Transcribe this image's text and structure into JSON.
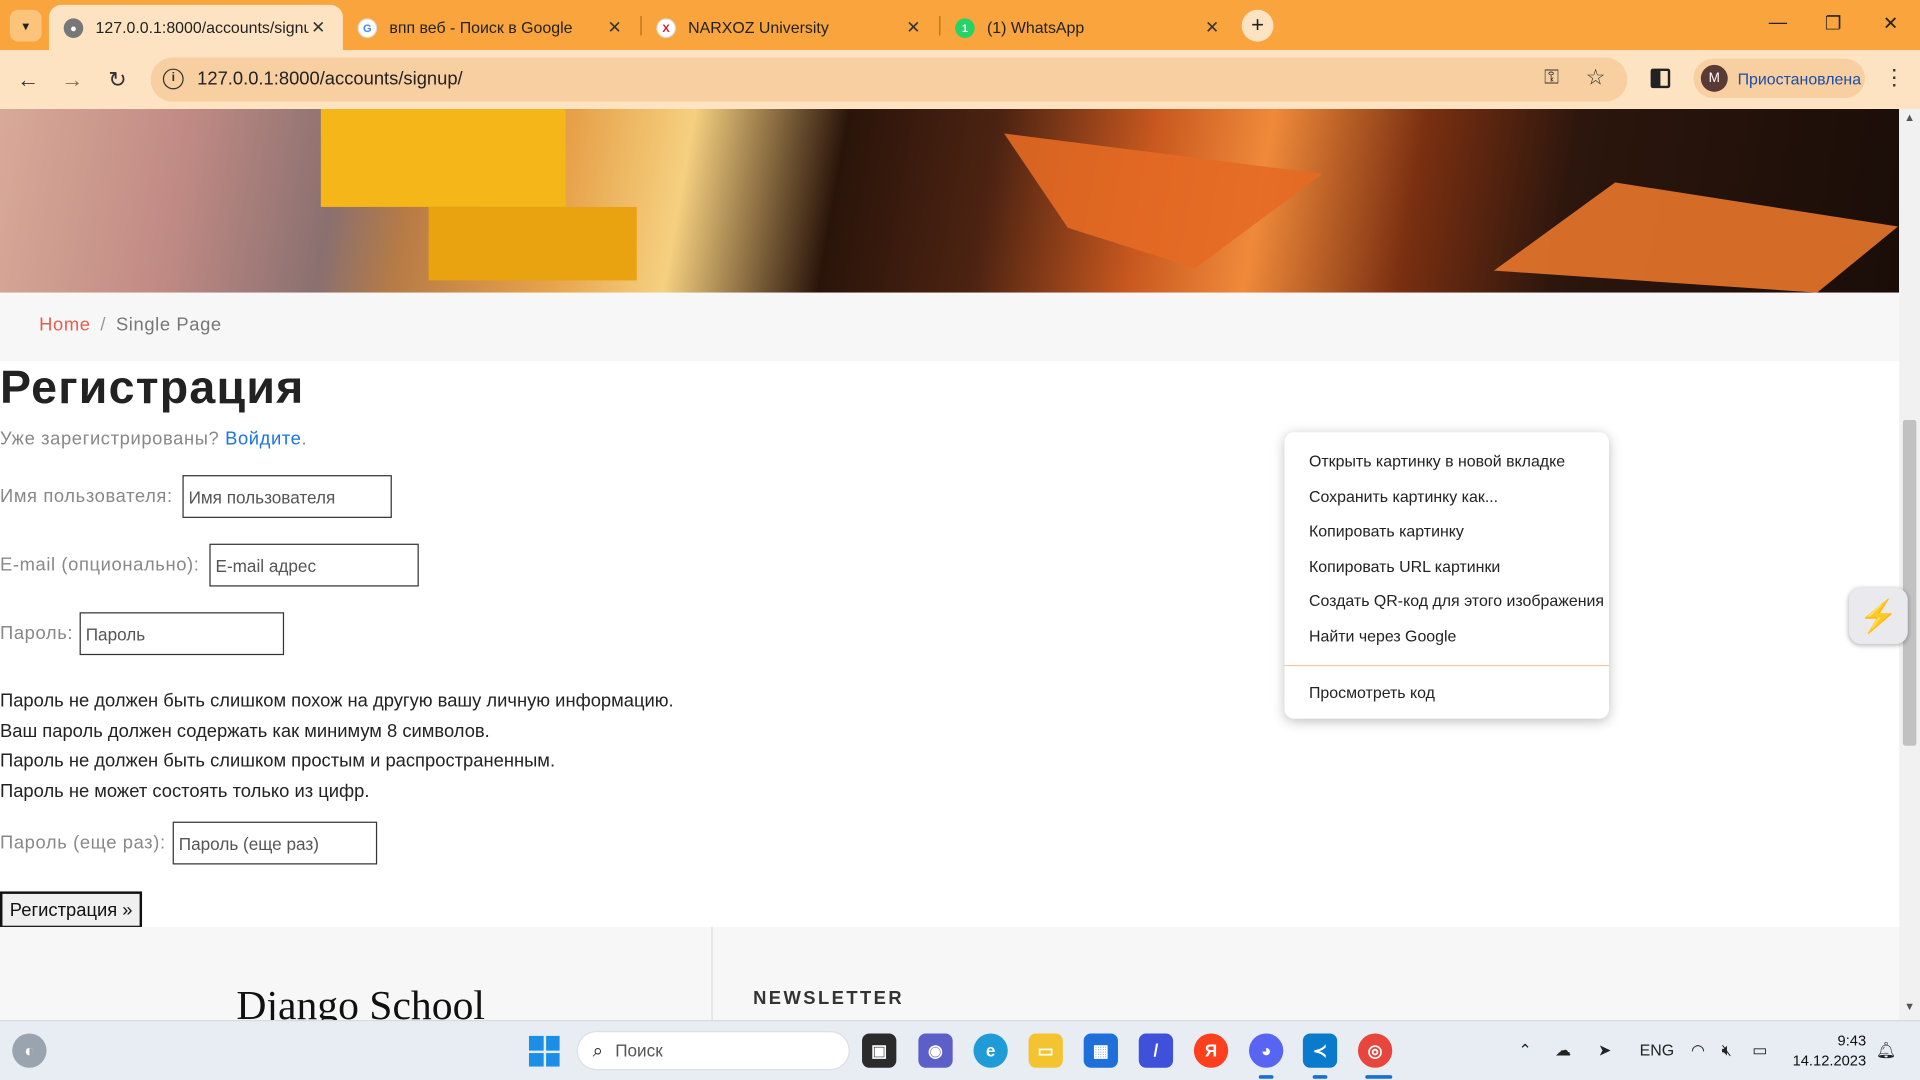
{
  "browser": {
    "tabs": [
      {
        "title": "127.0.0.1:8000/accounts/signup",
        "active": true,
        "favicon": "globe-icon"
      },
      {
        "title": "впп веб - Поиск в Google",
        "active": false,
        "favicon": "google-icon"
      },
      {
        "title": "NARXOZ University",
        "active": false,
        "favicon": "narxoz-icon"
      },
      {
        "title": "(1) WhatsApp",
        "active": false,
        "favicon": "whatsapp-icon"
      }
    ],
    "url": "127.0.0.1:8000/accounts/signup/",
    "profile_initial": "M",
    "profile_status": "Приостановлена"
  },
  "page": {
    "breadcrumb": {
      "home": "Home",
      "sep": "/",
      "current": "Single Page"
    },
    "heading": "Регистрация",
    "already_text": "Уже зарегистрированы?",
    "login_link": "Войдите",
    "login_dot": ".",
    "fields": {
      "username_label": "Имя пользователя:",
      "username_placeholder": "Имя пользователя",
      "email_label": "E-mail (опционально):",
      "email_placeholder": "E-mail адрес",
      "password_label": "Пароль:",
      "password_placeholder": "Пароль",
      "password2_label": "Пароль (еще раз):",
      "password2_placeholder": "Пароль (еще раз)"
    },
    "help_text": [
      "Пароль не должен быть слишком похож на другую вашу личную информацию.",
      "Ваш пароль должен содержать как минимум 8 символов.",
      "Пароль не должен быть слишком простым и распространенным.",
      "Пароль не может состоять только из цифр."
    ],
    "submit_label": "Регистрация »",
    "footer": {
      "brand": "Django School",
      "newsletter": "NEWSLETTER"
    }
  },
  "context_menu": {
    "items": [
      "Открыть картинку в новой вкладке",
      "Сохранить картинку как...",
      "Копировать картинку",
      "Копировать URL картинки",
      "Создать QR-код для этого изображения",
      "Найти через Google"
    ],
    "inspect": "Просмотреть код"
  },
  "taskbar": {
    "search_placeholder": "Поиск",
    "lang": "ENG",
    "time": "9:43",
    "date": "14.12.2023"
  },
  "colors": {
    "tabstrip": "#f9a43c",
    "toolbar": "#fde3c1",
    "link": "#1a73e8",
    "breadcrumb_home": "#e65c4f"
  }
}
